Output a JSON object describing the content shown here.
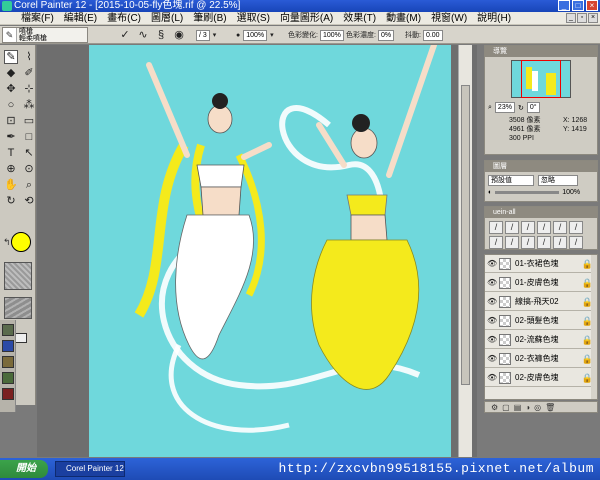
{
  "window": {
    "title": "Corel Painter 12 - [2015-10-05-fly色塊.rif @ 22.5%]"
  },
  "menu": [
    "檔案(F)",
    "編輯(E)",
    "畫布(C)",
    "圖層(L)",
    "筆刷(B)",
    "選取(S)",
    "向量圖形(A)",
    "效果(T)",
    "動畫(M)",
    "視窗(W)",
    "說明(H)"
  ],
  "propbar": {
    "brush_category": "噴槍",
    "brush_variant": "輕柔噴槍",
    "size_value": "/ 3",
    "opacity_value": "100%",
    "color_var_label": "色彩變化:",
    "color_var_value": "100%",
    "color_density_label": "色彩濃度:",
    "color_density_value": "0%",
    "jitter_label": "抖動:",
    "jitter_value": "0.00"
  },
  "navigator": {
    "title": "導覽",
    "zoom": "23%",
    "rotation": "0°",
    "width_label": "3508 像素",
    "height_label": "4961 像素",
    "res_label": "300 PPI",
    "x_label": "X:",
    "x_value": "1268",
    "y_label": "Y:",
    "y_value": "1419"
  },
  "layers_panel": {
    "title": "圖層",
    "composite_method": "預設值",
    "opacity_label": "忽略",
    "opacity_value": "100%"
  },
  "brush_library": {
    "title": "uein-all"
  },
  "layers": [
    {
      "name": "01-衣裙色塊"
    },
    {
      "name": "01-皮膚色塊"
    },
    {
      "name": "線搞-飛天02"
    },
    {
      "name": "02-頭髮色塊"
    },
    {
      "name": "02-流蘇色塊"
    },
    {
      "name": "02-衣褲色塊"
    },
    {
      "name": "02-皮膚色塊"
    }
  ],
  "taskbar": {
    "start_label": "開始",
    "item": "Corel Painter 12 - [..."
  },
  "watermark": "http://zxcvbn99518155.pixnet.net/album",
  "colors": {
    "main_color": "#ffff00",
    "canvas_bg": "#6fd8dc"
  }
}
